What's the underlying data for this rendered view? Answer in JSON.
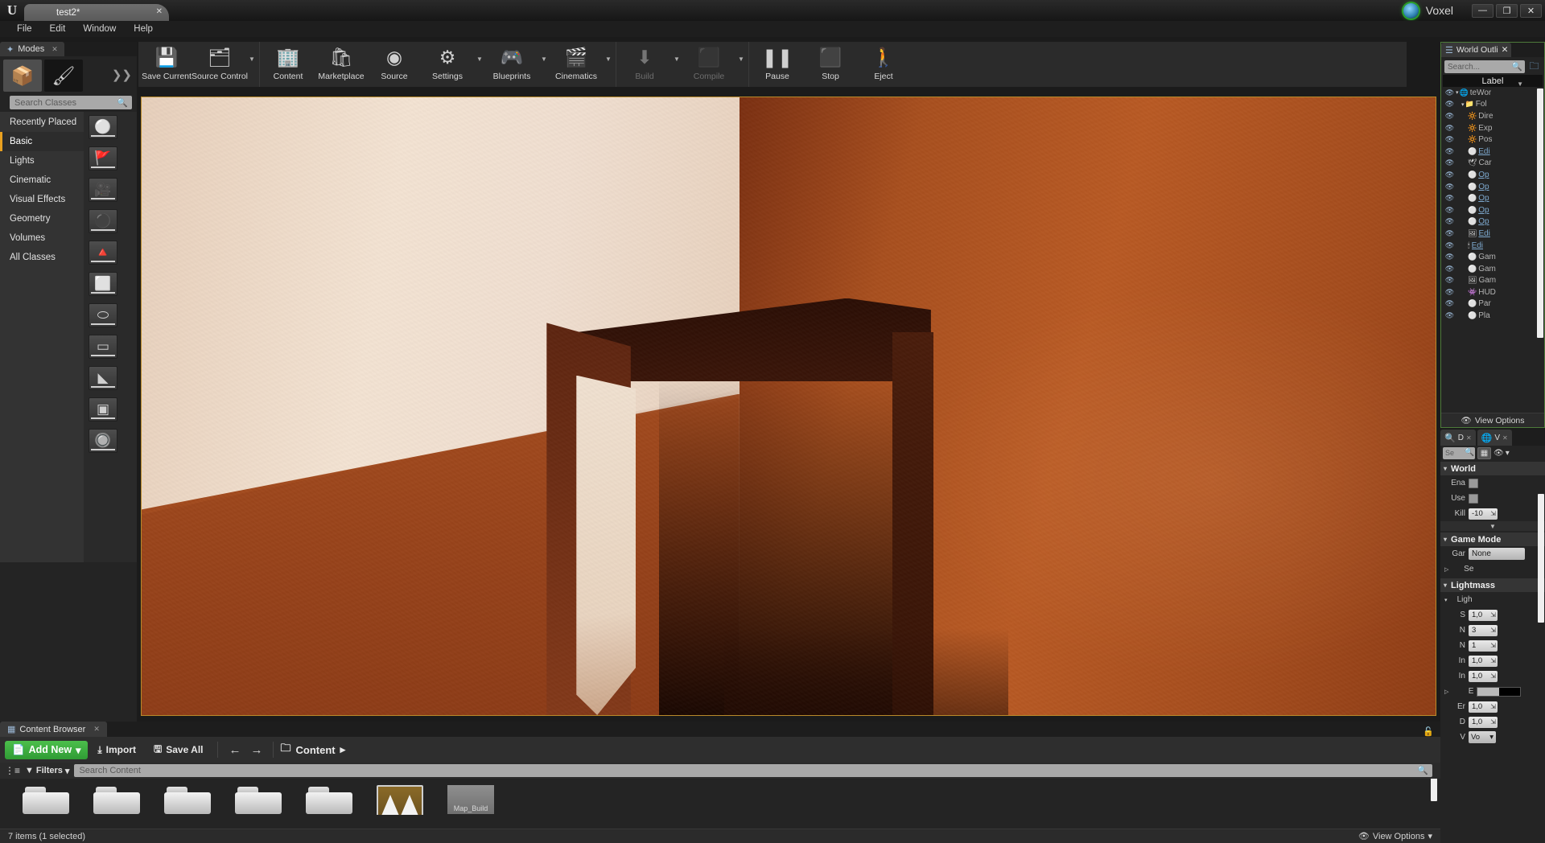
{
  "window": {
    "project_tab": "test2*",
    "app_badge": "Voxel",
    "minimize": "—",
    "maximize": "❐",
    "close": "✕",
    "logo": "U"
  },
  "menubar": {
    "items": [
      "File",
      "Edit",
      "Window",
      "Help"
    ]
  },
  "toolbar": {
    "groups": [
      {
        "buttons": [
          {
            "label": "Save Current",
            "icon": "save-icon",
            "glyph": "💾",
            "caret": false,
            "enabled": true
          },
          {
            "label": "Source Control",
            "icon": "source-control-icon",
            "glyph": "🗂",
            "caret": true,
            "enabled": true
          }
        ]
      },
      {
        "buttons": [
          {
            "label": "Content",
            "icon": "content-icon",
            "glyph": "🏢",
            "caret": false,
            "enabled": true
          },
          {
            "label": "Marketplace",
            "icon": "marketplace-icon",
            "glyph": "🛍",
            "caret": false,
            "enabled": true
          },
          {
            "label": "Source",
            "icon": "source-icon",
            "glyph": "◉",
            "caret": false,
            "enabled": true
          },
          {
            "label": "Settings",
            "icon": "settings-gear-icon",
            "glyph": "⚙",
            "caret": true,
            "enabled": true
          },
          {
            "label": "Blueprints",
            "icon": "blueprints-icon",
            "glyph": "🎮",
            "caret": true,
            "enabled": true
          },
          {
            "label": "Cinematics",
            "icon": "cinematics-clapper-icon",
            "glyph": "🎬",
            "caret": true,
            "enabled": true
          }
        ]
      },
      {
        "buttons": [
          {
            "label": "Build",
            "icon": "build-icon",
            "glyph": "⬇",
            "caret": true,
            "enabled": false
          },
          {
            "label": "Compile",
            "icon": "compile-cube-icon",
            "glyph": "⬛",
            "caret": true,
            "enabled": false
          }
        ]
      },
      {
        "buttons": [
          {
            "label": "Pause",
            "icon": "pause-icon",
            "glyph": "❚❚",
            "caret": false,
            "enabled": true
          },
          {
            "label": "Stop",
            "icon": "stop-icon",
            "glyph": "⬛",
            "caret": false,
            "enabled": true
          },
          {
            "label": "Eject",
            "icon": "eject-person-icon",
            "glyph": "🚶",
            "caret": false,
            "enabled": true
          }
        ]
      }
    ]
  },
  "modes": {
    "tab_title": "Modes",
    "tab_close": "✕",
    "mode_buttons": [
      {
        "name": "place-mode",
        "glyph": "📦",
        "selected": true
      },
      {
        "name": "paint-mode",
        "glyph": "🖌",
        "selected": false
      }
    ],
    "more_modes": "❯❯",
    "search_placeholder": "Search Classes",
    "categories": [
      {
        "label": "Recently Placed",
        "active": false
      },
      {
        "label": "Basic",
        "active": true
      },
      {
        "label": "Lights",
        "active": false
      },
      {
        "label": "Cinematic",
        "active": false
      },
      {
        "label": "Visual Effects",
        "active": false
      },
      {
        "label": "Geometry",
        "active": false
      },
      {
        "label": "Volumes",
        "active": false
      },
      {
        "label": "All Classes",
        "active": false
      }
    ],
    "thumbnails": [
      {
        "name": "sphere-actor-thumb",
        "glyph": "⚪"
      },
      {
        "name": "player-start-thumb",
        "glyph": "🚩"
      },
      {
        "name": "camera-actor-thumb",
        "glyph": "🎥"
      },
      {
        "name": "sphere-thumb",
        "glyph": "⚫"
      },
      {
        "name": "cone-thumb",
        "glyph": "🔺"
      },
      {
        "name": "cube-thumb",
        "glyph": "⬜"
      },
      {
        "name": "cylinder-thumb",
        "glyph": "⬭"
      },
      {
        "name": "plane-thumb",
        "glyph": "▭"
      },
      {
        "name": "wedge-thumb",
        "glyph": "◣"
      },
      {
        "name": "box-thumb",
        "glyph": "▣"
      },
      {
        "name": "sphere2-thumb",
        "glyph": "🔘"
      }
    ]
  },
  "outliner": {
    "tab_title": "World Outli",
    "tab_close": "✕",
    "search_placeholder": "Search...",
    "add_icon": "add-folder-icon",
    "column_header": "Label",
    "rows": [
      {
        "label": "teWor",
        "indent": 0,
        "expander": "▾",
        "icon": "🌐",
        "link": false
      },
      {
        "label": "Fol",
        "indent": 1,
        "expander": "▾",
        "icon": "📁",
        "link": false
      },
      {
        "label": "Dire",
        "indent": 2,
        "expander": "",
        "icon": "🔆",
        "link": false
      },
      {
        "label": "Exp",
        "indent": 2,
        "expander": "",
        "icon": "🔆",
        "link": false
      },
      {
        "label": "Pos",
        "indent": 2,
        "expander": "",
        "icon": "🔆",
        "link": false
      },
      {
        "label": "Edi",
        "indent": 2,
        "expander": "",
        "icon": "⚪",
        "link": true
      },
      {
        "label": "Car",
        "indent": 2,
        "expander": "",
        "icon": "🕊",
        "link": false
      },
      {
        "label": "Op",
        "indent": 2,
        "expander": "",
        "icon": "⚪",
        "link": true
      },
      {
        "label": "Op",
        "indent": 2,
        "expander": "",
        "icon": "⚪",
        "link": true
      },
      {
        "label": "Op",
        "indent": 2,
        "expander": "",
        "icon": "⚪",
        "link": true
      },
      {
        "label": "Op",
        "indent": 2,
        "expander": "",
        "icon": "⚪",
        "link": true
      },
      {
        "label": "Op",
        "indent": 2,
        "expander": "",
        "icon": "⚪",
        "link": true
      },
      {
        "label": "Edi",
        "indent": 2,
        "expander": "",
        "icon": "🖼",
        "link": true
      },
      {
        "label": "Edi",
        "indent": 2,
        "expander": "",
        "icon": "🕯",
        "link": true
      },
      {
        "label": "Gam",
        "indent": 2,
        "expander": "",
        "icon": "⚪",
        "link": false
      },
      {
        "label": "Gam",
        "indent": 2,
        "expander": "",
        "icon": "⚪",
        "link": false
      },
      {
        "label": "Gam",
        "indent": 2,
        "expander": "",
        "icon": "🖼",
        "link": false
      },
      {
        "label": "HUD",
        "indent": 2,
        "expander": "",
        "icon": "👾",
        "link": false
      },
      {
        "label": "Par",
        "indent": 2,
        "expander": "",
        "icon": "⚪",
        "link": false
      },
      {
        "label": "Pla",
        "indent": 2,
        "expander": "",
        "icon": "⚪",
        "link": false
      }
    ],
    "view_options": "View Options",
    "view_options_icon": "eye-icon"
  },
  "details": {
    "tabs": [
      {
        "label": "D",
        "icon": "details-magnifier-icon",
        "close": "✕"
      },
      {
        "label": "V",
        "icon": "world-settings-globe-icon",
        "close": "✕"
      }
    ],
    "search_placeholder": "Se",
    "grid_icon": "grid-icon",
    "eye_icon": "eye-icon",
    "sections": [
      {
        "title": "World",
        "rows": [
          {
            "name": "Ena",
            "type": "checkbox"
          },
          {
            "name": "Use",
            "type": "checkbox"
          },
          {
            "name": "Kill",
            "type": "value",
            "value": "-10"
          }
        ],
        "collapse": "▼"
      },
      {
        "title": "Game Mode",
        "rows": [
          {
            "name": "Gar",
            "type": "combo",
            "value": "None"
          },
          {
            "name": "Se",
            "type": "tree",
            "value": "",
            "expander": "▷"
          }
        ]
      },
      {
        "title": "Lightmass",
        "rows": [
          {
            "name": "Ligh",
            "type": "group",
            "expander": "▾"
          },
          {
            "name": "S",
            "type": "value",
            "value": "1,0"
          },
          {
            "name": "N",
            "type": "value",
            "value": "3"
          },
          {
            "name": "N",
            "type": "value",
            "value": "1"
          },
          {
            "name": "In",
            "type": "value",
            "value": "1,0"
          },
          {
            "name": "In",
            "type": "value",
            "value": "1,0"
          },
          {
            "name": "E",
            "type": "swatch",
            "expander": "▷"
          },
          {
            "name": "Er",
            "type": "value",
            "value": "1,0"
          },
          {
            "name": "D",
            "type": "value",
            "value": "1,0"
          },
          {
            "name": "V",
            "type": "combo-small",
            "value": "Vo"
          }
        ]
      }
    ]
  },
  "content_browser": {
    "tab_title": "Content Browser",
    "tab_close": "✕",
    "add_new": "Add New",
    "add_new_caret": "▾",
    "import": "Import",
    "save_all": "Save All",
    "back_arrow": "←",
    "forward_arrow": "→",
    "breadcrumb_root": "Content",
    "breadcrumb_caret": "▸",
    "filters": "Filters",
    "filters_caret": "▾",
    "search_placeholder": "Search Content",
    "assets": [
      {
        "type": "folder",
        "name": "folder-item"
      },
      {
        "type": "folder",
        "name": "folder-item"
      },
      {
        "type": "folder",
        "name": "folder-item"
      },
      {
        "type": "folder",
        "name": "folder-item"
      },
      {
        "type": "folder",
        "name": "folder-item"
      },
      {
        "type": "map",
        "name": "map-asset",
        "label": ""
      },
      {
        "type": "gray",
        "name": "map-build-asset",
        "label": "Map_Build"
      }
    ],
    "status": "7 items (1 selected)",
    "view_options": "View Options",
    "view_options_caret": "▾"
  },
  "viewport": {
    "name": "level-viewport",
    "description": "3D level view: cream plaster wall on left, red-orange plaster wall on right, dark recessed doorway/box in center with light shaft"
  },
  "colors": {
    "accent_orange": "#e8a020",
    "add_new_green": "#2f9b34",
    "outliner_border_green": "#4d7a3a",
    "viewport_border": "#b98a2a",
    "panel_bg": "#242424",
    "link_blue": "#7ea9cf"
  }
}
